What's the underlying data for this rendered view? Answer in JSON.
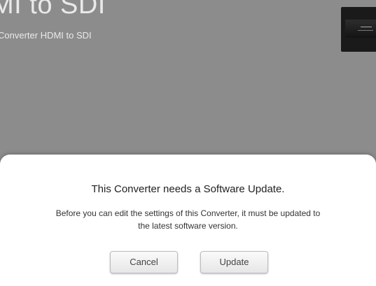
{
  "page": {
    "title": "MI to SDI",
    "subtitle": "Converter HDMI to SDI"
  },
  "dialog": {
    "title": "This Converter needs a Software Update.",
    "message_line1": "Before you can edit the settings of this Converter, it must be updated to",
    "message_line2": "the latest software version.",
    "cancel_label": "Cancel",
    "update_label": "Update"
  },
  "colors": {
    "backdrop": "#8c8c8c",
    "dialog_background": "#ffffff",
    "title_text": "#e9e9e9"
  },
  "icons": {
    "device": "converter-device-icon"
  }
}
